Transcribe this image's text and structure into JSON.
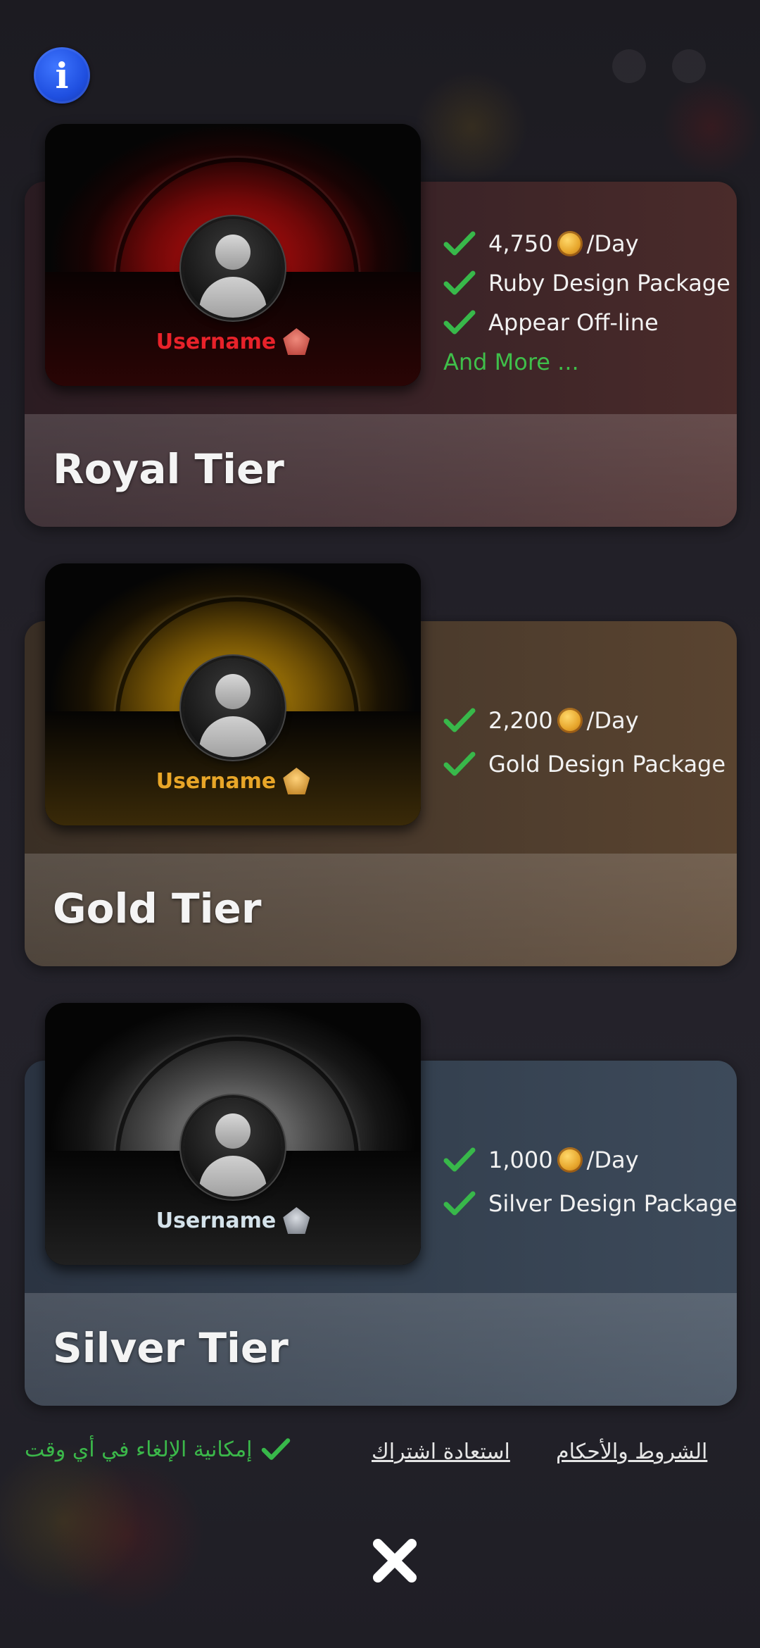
{
  "info_button": {
    "icon": "info-icon",
    "label": "i",
    "color": "#2a5fff"
  },
  "tiers": [
    {
      "name": "Royal Tier",
      "accent": "#e02020",
      "username": "Username",
      "badge_color": "#d0584f",
      "benefits": [
        {
          "amount": "4,750",
          "unit": "/Day"
        },
        {
          "text": "Ruby Design Package"
        },
        {
          "text": "Appear Off-line"
        }
      ],
      "more_label": "And More ..."
    },
    {
      "name": "Gold Tier",
      "accent": "#e0a21f",
      "username": "Username",
      "badge_color": "#d89a2c",
      "benefits": [
        {
          "amount": "2,200",
          "unit": "/Day"
        },
        {
          "text": "Gold Design Package"
        }
      ]
    },
    {
      "name": "Silver Tier",
      "accent": "#cfd8df",
      "username": "Username",
      "badge_color": "#8b8f98",
      "benefits": [
        {
          "amount": "1,000",
          "unit": "/Day"
        },
        {
          "text": "Silver Design Package"
        }
      ]
    }
  ],
  "footer": {
    "cancel_note": "إمكانية الإلغاء في أي وقت",
    "restore_link": "استعادة اشتراك",
    "terms_link": "الشروط والأحكام"
  },
  "close_button": {
    "icon": "close-icon"
  },
  "colors": {
    "check_green": "#38b84a",
    "note_green": "#3bb84a"
  }
}
